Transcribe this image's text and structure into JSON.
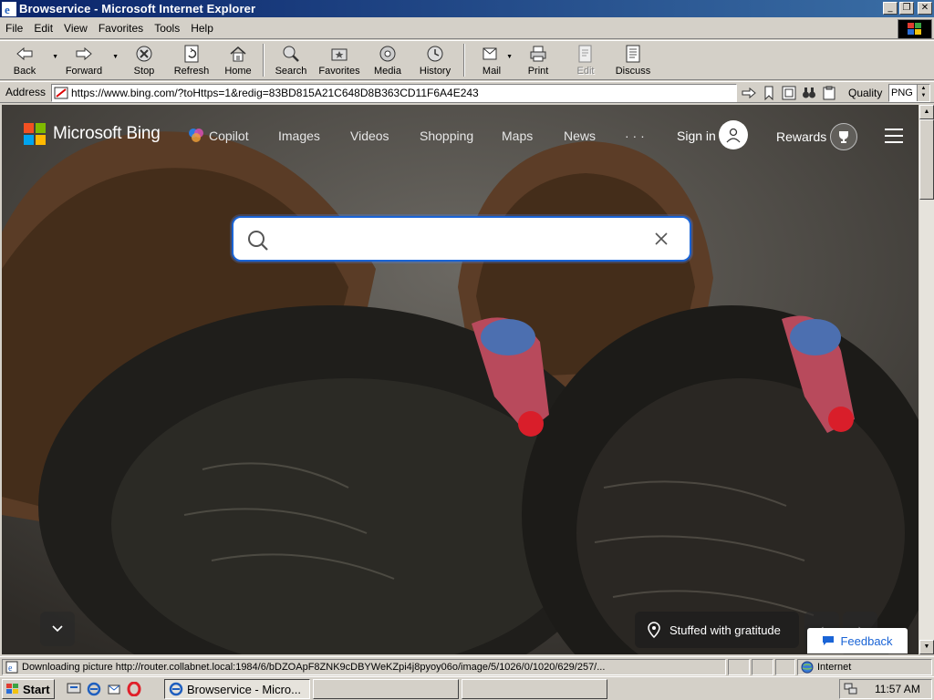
{
  "window": {
    "title": "Browservice - Microsoft Internet Explorer"
  },
  "menubar": {
    "items": [
      "File",
      "Edit",
      "View",
      "Favorites",
      "Tools",
      "Help"
    ]
  },
  "toolbar": {
    "back": "Back",
    "forward": "Forward",
    "stop": "Stop",
    "refresh": "Refresh",
    "home": "Home",
    "search": "Search",
    "favorites": "Favorites",
    "media": "Media",
    "history": "History",
    "mail": "Mail",
    "print": "Print",
    "edit": "Edit",
    "discuss": "Discuss"
  },
  "addressbar": {
    "label": "Address",
    "url": "https://www.bing.com/?toHttps=1&redig=83BD815A21C648D8B363CD11F6A4E243",
    "quality_label": "Quality",
    "quality_value": "PNG"
  },
  "bing": {
    "logo_text": "Microsoft Bing",
    "nav": [
      "Copilot",
      "Images",
      "Videos",
      "Shopping",
      "Maps",
      "News",
      "· · ·"
    ],
    "signin": "Sign in",
    "rewards": "Rewards",
    "search_value": "",
    "caption": "Stuffed with gratitude",
    "feedback": "Feedback"
  },
  "statusbar": {
    "message": "Downloading picture http://router.collabnet.local:1984/6/bDZOApF8ZNK9cDBYWeKZpi4j8pyoy06o/image/5/1026/0/1020/629/257/...",
    "zone": "Internet"
  },
  "taskbar": {
    "start": "Start",
    "task": "Browservice - Micro...",
    "clock": "11:57 AM"
  },
  "colors": {
    "title_bar": "#0a246a",
    "chrome": "#d4d0c8",
    "bing_accent": "#1a64d6"
  }
}
